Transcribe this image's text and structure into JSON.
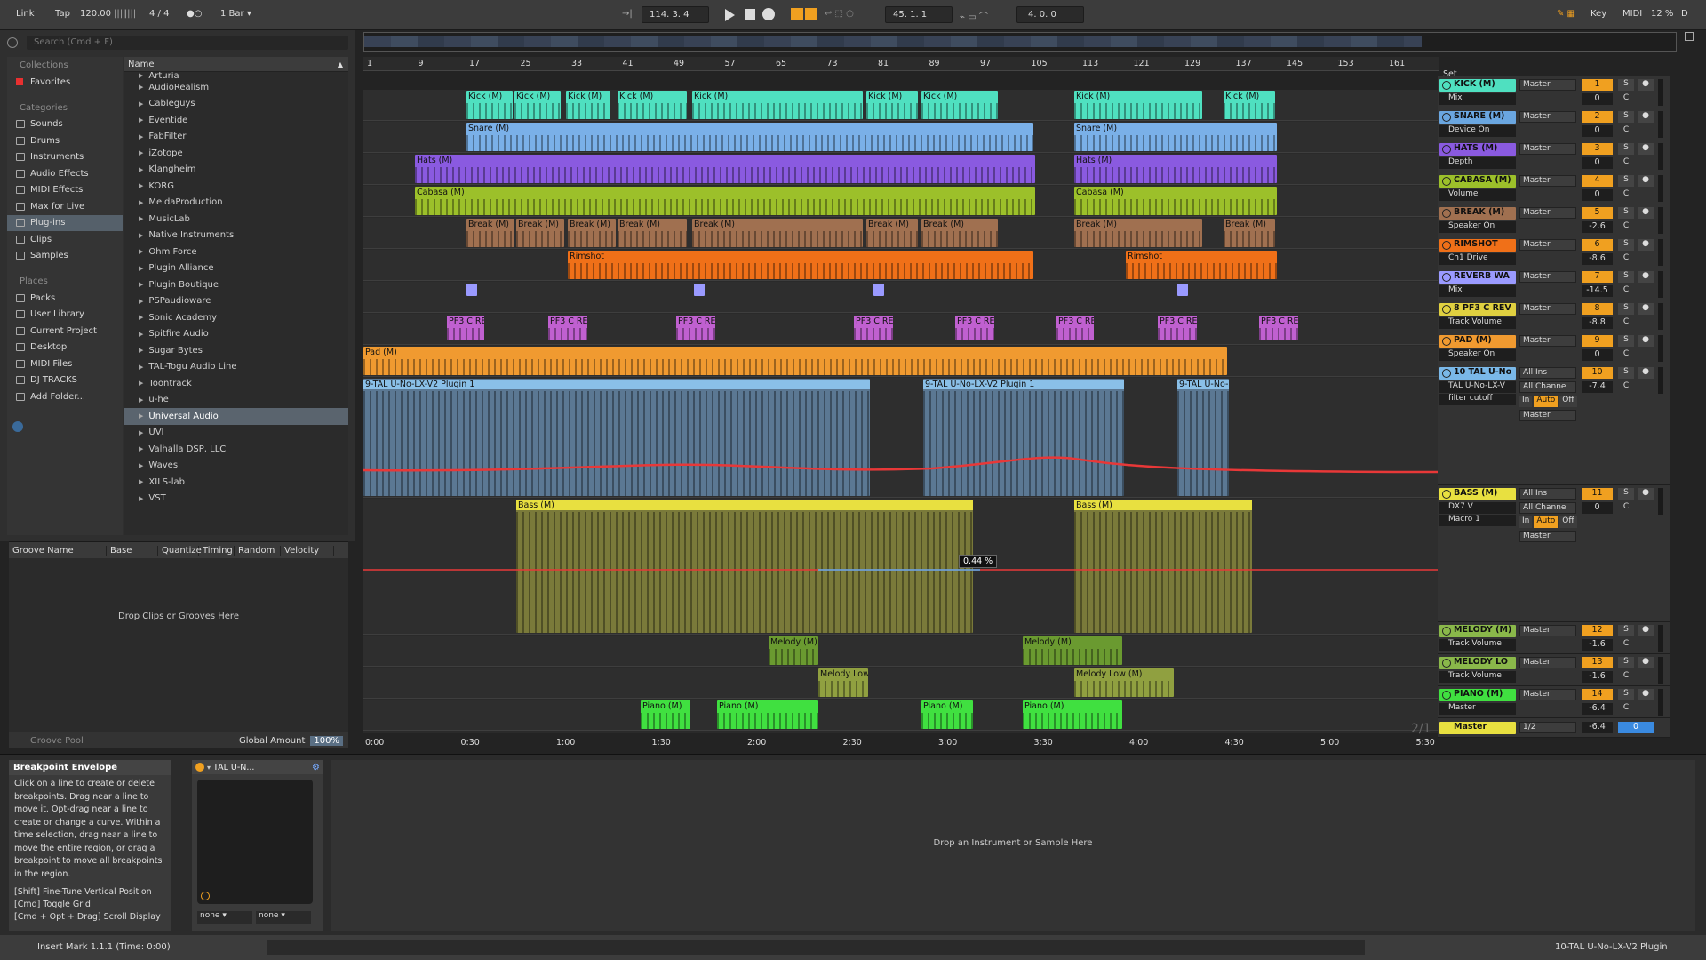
{
  "topbar": {
    "link": "Link",
    "tap": "Tap",
    "tempo": "120.00",
    "sig": "4 / 4",
    "rec_mode": "●○",
    "quant": "1 Bar",
    "position": "114.  3.  4",
    "loop_start": "45.  1.  1",
    "loop_len": "4.  0.  0",
    "key": "Key",
    "midi": "MIDI",
    "cpu": "12 %",
    "d": "D"
  },
  "browser": {
    "search_placeholder": "Search (Cmd + F)",
    "collections_label": "Collections",
    "favorites": "Favorites",
    "categories_label": "Categories",
    "categories": [
      "Sounds",
      "Drums",
      "Instruments",
      "Audio Effects",
      "MIDI Effects",
      "Max for Live",
      "Plug-ins",
      "Clips",
      "Samples"
    ],
    "places_label": "Places",
    "places": [
      "Packs",
      "User Library",
      "Current Project",
      "Desktop",
      "MIDI Files",
      "DJ TRACKS",
      "Add Folder..."
    ],
    "name_header": "Name",
    "items": [
      "Arturia",
      "AudioRealism",
      "Cableguys",
      "Eventide",
      "FabFilter",
      "iZotope",
      "Klangheim",
      "KORG",
      "MeldaProduction",
      "MusicLab",
      "Native Instruments",
      "Ohm Force",
      "Plugin Alliance",
      "Plugin Boutique",
      "PSPaudioware",
      "Sonic Academy",
      "Spitfire Audio",
      "Sugar Bytes",
      "TAL-Togu Audio Line",
      "Toontrack",
      "u-he",
      "Universal Audio",
      "UVI",
      "Valhalla DSP, LLC",
      "Waves",
      "XILS-lab",
      "VST"
    ]
  },
  "groove": {
    "headers": [
      "Groove Name",
      "Base",
      "Quantize",
      "Timing",
      "Random",
      "Velocity"
    ],
    "drop_text": "Drop Clips or Grooves Here",
    "pool": "Groove Pool",
    "global_amount_label": "Global Amount",
    "global_amount": "100%"
  },
  "ruler": {
    "bars": [
      "1",
      "9",
      "17",
      "25",
      "33",
      "41",
      "49",
      "57",
      "65",
      "73",
      "81",
      "89",
      "97",
      "105",
      "113",
      "121",
      "129",
      "137",
      "145",
      "153",
      "161"
    ],
    "times": [
      "0:00",
      "0:30",
      "1:00",
      "1:30",
      "2:00",
      "2:30",
      "3:00",
      "3:30",
      "4:00",
      "4:30",
      "5:00",
      "5:30"
    ],
    "set_label": "Set",
    "page": "2/1"
  },
  "lanes": [
    {
      "clips": [
        {
          "n": "Kick (M)"
        },
        {
          "n": "Kick (M)"
        },
        {
          "n": "Kick (M)"
        },
        {
          "n": "Kick (M)"
        },
        {
          "n": "Kick (M)"
        },
        {
          "n": "Kick (M)"
        },
        {
          "n": "Kick (M)"
        },
        {
          "n": "Kick (M)"
        },
        {
          "n": "Kick (M)"
        }
      ]
    },
    {
      "clips": [
        {
          "n": "Snare (M)"
        },
        {
          "n": "Snare (M)"
        }
      ]
    },
    {
      "clips": [
        {
          "n": "Hats (M)"
        },
        {
          "n": "Hats (M)"
        }
      ]
    },
    {
      "clips": [
        {
          "n": "Cabasa (M)"
        },
        {
          "n": "Cabasa (M)"
        }
      ]
    },
    {
      "clips": [
        {
          "n": "Break (M)"
        },
        {
          "n": "Break (M)"
        },
        {
          "n": "Break (M)"
        },
        {
          "n": "Break (M)"
        },
        {
          "n": "Break (M)"
        },
        {
          "n": "Break (M)"
        },
        {
          "n": "Break (M)"
        },
        {
          "n": "Break (M)"
        },
        {
          "n": "Break (M)"
        }
      ]
    },
    {
      "clips": [
        {
          "n": "Rimshot"
        },
        {
          "n": "Rimshot"
        }
      ]
    },
    {
      "clips": [
        {
          "n": ""
        },
        {
          "n": ""
        },
        {
          "n": ""
        },
        {
          "n": ""
        }
      ]
    },
    {
      "clips": [
        {
          "n": "PF3 C RE"
        },
        {
          "n": "PF3 C RE"
        },
        {
          "n": "PF3 C RE"
        },
        {
          "n": "PF3 C RE"
        },
        {
          "n": "PF3 C RE"
        },
        {
          "n": "PF3 C RE"
        },
        {
          "n": "PF3 C RE"
        },
        {
          "n": "PF3 C RE"
        }
      ]
    },
    {
      "clips": [
        {
          "n": "Pad (M)"
        }
      ]
    },
    {
      "clips": [
        {
          "n": "9-TAL U-No-LX-V2 Plugin 1"
        },
        {
          "n": "9-TAL U-No-LX-V2 Plugin 1"
        },
        {
          "n": "9-TAL U-No-"
        }
      ]
    },
    {
      "clips": [
        {
          "n": "Bass (M)"
        },
        {
          "n": "Bass (M)"
        }
      ],
      "auto_value": "0.44 %"
    },
    {
      "clips": [
        {
          "n": "Melody (M)"
        },
        {
          "n": "Melody (M)"
        }
      ]
    },
    {
      "clips": [
        {
          "n": "Melody Low"
        },
        {
          "n": "Melody Low  (M)"
        }
      ]
    },
    {
      "clips": [
        {
          "n": "Piano (M)"
        },
        {
          "n": "Piano (M)"
        },
        {
          "n": "Piano (M)"
        },
        {
          "n": "Piano (M)"
        }
      ]
    }
  ],
  "tracks": [
    {
      "name": "KICK (M)",
      "sub": "Mix",
      "route": "Master",
      "num": "1",
      "vol": "0",
      "color": "#4fe0c0"
    },
    {
      "name": "SNARE (M)",
      "sub": "Device On",
      "route": "Master",
      "num": "2",
      "vol": "0",
      "color": "#6aa6e0"
    },
    {
      "name": "HATS (M)",
      "sub": "Depth",
      "route": "Master",
      "num": "3",
      "vol": "0",
      "color": "#8a5ae0"
    },
    {
      "name": "CABASA (M)",
      "sub": "Volume",
      "route": "Master",
      "num": "4",
      "vol": "0",
      "color": "#9cc02a"
    },
    {
      "name": "BREAK (M)",
      "sub": "Speaker On",
      "route": "Master",
      "num": "5",
      "vol": "-2.6",
      "color": "#a07050"
    },
    {
      "name": "RIMSHOT",
      "sub": "Ch1 Drive",
      "route": "Master",
      "num": "6",
      "vol": "-8.6",
      "color": "#f07018"
    },
    {
      "name": "REVERB WA",
      "sub": "Mix",
      "route": "Master",
      "num": "7",
      "vol": "-14.5",
      "color": "#9a9aff"
    },
    {
      "name": "8 PF3 C REV",
      "sub": "Track Volume",
      "route": "Master",
      "num": "8",
      "vol": "-8.8",
      "color": "#e0d040"
    },
    {
      "name": "PAD (M)",
      "sub": "Speaker On",
      "route": "Master",
      "num": "9",
      "vol": "0",
      "color": "#f09a30"
    },
    {
      "name": "10 TAL U-No",
      "sub": "TAL U-No-LX-V",
      "sub2": "filter cutoff",
      "route": "All Ins",
      "route2": "All Channe",
      "route3": "Master",
      "num": "10",
      "vol": "-7.4",
      "color": "#7ab8e8"
    },
    {
      "name": "BASS (M)",
      "sub": "DX7 V",
      "sub2": "Macro 1",
      "route": "All Ins",
      "route2": "All Channe",
      "route3": "Master",
      "num": "11",
      "vol": "0",
      "color": "#e8e040"
    },
    {
      "name": "MELODY (M)",
      "sub": "Track Volume",
      "route": "Master",
      "num": "12",
      "vol": "-1.6",
      "color": "#8ab84a"
    },
    {
      "name": "MELODY LO",
      "sub": "Track Volume",
      "route": "Master",
      "num": "13",
      "vol": "-1.6",
      "color": "#8ab84a"
    },
    {
      "name": "PIANO (M)",
      "sub": "Master",
      "route": "Master",
      "num": "14",
      "vol": "-6.4",
      "color": "#40e040"
    }
  ],
  "mixer_labels": {
    "in": "In",
    "auto": "Auto",
    "off": "Off",
    "s": "S",
    "c": "C",
    "master_sub": "1/2",
    "master_vol": "0"
  },
  "bottom": {
    "info_title": "Breakpoint Envelope",
    "info_text": "Click on a line to create or delete breakpoints. Drag near a line to move it. Opt-drag near a line to create or change a curve. Within a time selection, drag near a line to move the entire region, or drag a breakpoint to move all breakpoints in the region.",
    "info_keys": [
      "[Shift] Fine-Tune Vertical Position",
      "[Cmd] Toggle Grid",
      "[Cmd + Opt + Drag] Scroll Display"
    ],
    "device_name": "TAL U-N...",
    "none1": "none",
    "none2": "none",
    "drop_text": "Drop an Instrument or Sample Here"
  },
  "status": {
    "text": "Insert Mark 1.1.1 (Time: 0:00)",
    "right": "10-TAL U-No-LX-V2 Plugin"
  }
}
